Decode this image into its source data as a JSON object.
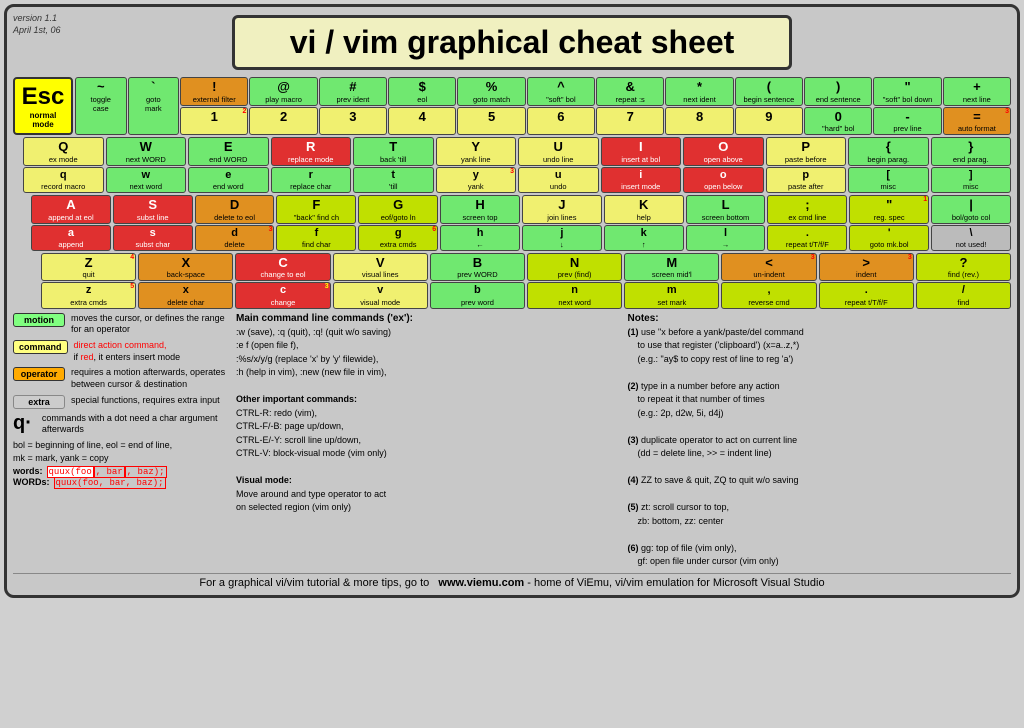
{
  "version": "version 1.1\nApril 1st, 06",
  "title": "vi / vim graphical cheat sheet",
  "esc": {
    "label": "Esc",
    "sub1": "normal",
    "sub2": "mode"
  },
  "num_row": [
    {
      "char": "~",
      "desc1": "toggle",
      "desc2": "case",
      "bg": "green"
    },
    {
      "char": "`",
      "desc1": "goto",
      "desc2": "mark",
      "bg": "green"
    },
    {
      "char": "!",
      "desc1": "external",
      "desc2": "filter",
      "bg": "orange"
    },
    {
      "char": "1",
      "sup": "2",
      "bg": "yellow"
    },
    {
      "char": "@",
      "desc1": "play",
      "desc2": "macro",
      "bg": "green"
    },
    {
      "char": "2",
      "bg": "yellow"
    },
    {
      "char": "#",
      "desc1": "prev",
      "desc2": "ident",
      "bg": "green"
    },
    {
      "char": "3",
      "bg": "yellow"
    },
    {
      "char": "$",
      "desc1": "eol",
      "bg": "green"
    },
    {
      "char": "4",
      "bg": "yellow"
    },
    {
      "char": "%",
      "desc1": "goto",
      "desc2": "match",
      "bg": "green"
    },
    {
      "char": "5",
      "bg": "yellow"
    },
    {
      "char": "^",
      "desc1": "\"soft\"",
      "desc2": "bol",
      "bg": "green"
    },
    {
      "char": "6",
      "bg": "yellow"
    },
    {
      "char": "&",
      "desc1": "repeat",
      "desc2": ":s",
      "bg": "green"
    },
    {
      "char": "7",
      "bg": "yellow"
    },
    {
      "char": "*",
      "desc1": "next",
      "desc2": "ident",
      "bg": "green"
    },
    {
      "char": "8",
      "bg": "yellow"
    },
    {
      "char": "(",
      "desc1": "begin",
      "desc2": "sentence",
      "bg": "green"
    },
    {
      "char": "9",
      "bg": "yellow"
    },
    {
      "char": ")",
      "desc1": "end",
      "desc2": "sentence",
      "bg": "green"
    },
    {
      "char": "0",
      "desc1": "\"hard\" bol",
      "bg": "green"
    },
    {
      "char": "\"",
      "desc1": "\"soft\" bol",
      "desc2": "down",
      "bg": "green"
    },
    {
      "char": "+",
      "desc1": "next",
      "desc2": "line",
      "bg": "green"
    },
    {
      "char": "-",
      "desc1": "prev",
      "desc2": "line",
      "bg": "green"
    },
    {
      "char": "=",
      "desc1": "auto",
      "desc2": "format",
      "bg": "orange",
      "sup": "3"
    }
  ],
  "footer": {
    "text": "For a graphical vi/vim tutorial & more tips, go to",
    "url": "www.viemu.com",
    "suffix": " - home of ViEmu, vi/vim emulation for Microsoft Visual Studio"
  },
  "legend": {
    "motion_label": "motion",
    "motion_desc": "moves the cursor, or defines the range for an operator",
    "command_label": "command",
    "command_desc1": "direct action command,",
    "command_desc2": "if red, it enters insert mode",
    "operator_label": "operator",
    "operator_desc": "requires a motion afterwards, operates between cursor & destination",
    "extra_label": "extra",
    "extra_desc": "special functions, requires extra input",
    "dot_desc": "commands with a dot need a char argument afterwards",
    "bol_line": "bol = beginning of line, eol = end of line,",
    "mk_line": "mk = mark, yank = copy",
    "words_label": "words:",
    "words_example": "quux(foo, bar, baz);",
    "WORDS_label": "WORDs:",
    "WORDS_example": "quux(foo, bar, baz);"
  },
  "main_commands": {
    "heading": "Main command line commands ('ex'):",
    "lines": [
      ":w (save), :q (quit), :q! (quit w/o saving)",
      ":e f (open file f),",
      ":%s/x/y/g (replace 'x' by 'y' filewide),",
      ":h (help in vim), :new (new file in vim),",
      "",
      "Other important commands:",
      "CTRL-R: redo (vim),",
      "CTRL-F/-B: page up/down,",
      "CTRL-E/-Y: scroll line up/down,",
      "CTRL-V: block-visual mode (vim only)",
      "",
      "Visual mode:",
      "Move around and type operator to act",
      "on selected region (vim only)"
    ]
  },
  "notes": {
    "heading": "Notes:",
    "items": [
      "(1) use \"x before a yank/paste/del command\n    to use that register ('clipboard') (x=a..z,*)\n    (e.g.: \"ay$ to copy rest of line to reg 'a')",
      "(2) type in a number before any action\n    to repeat it that number of times\n    (e.g.: 2p, d2w, 5i, d4j)",
      "(3) duplicate operator to act on current line\n    (dd = delete line, >> = indent line)",
      "(4) ZZ to save & quit, ZQ to quit w/o saving",
      "(5) zt: scroll cursor to top,\n    zb: bottom, zz: center",
      "(6) gg: top of file (vim only),\n    gf: open file under cursor (vim only)"
    ]
  }
}
